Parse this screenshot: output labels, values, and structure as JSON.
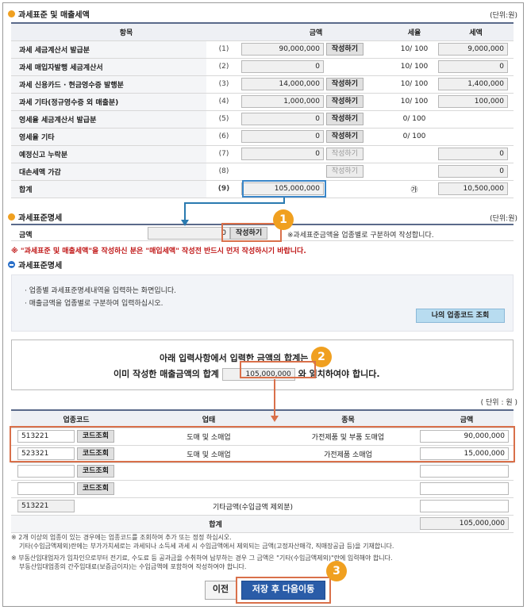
{
  "section1": {
    "title": "과세표준 및 매출세액",
    "unit": "(단위:원)",
    "headers": [
      "항목",
      "금액",
      "세율",
      "세액"
    ],
    "rows": [
      {
        "label": "과세 세금계산서 발급분",
        "no": "(1)",
        "amount": "90,000,000",
        "button": "작성하기",
        "rate": "10/ 100",
        "tax": "9,000,000"
      },
      {
        "label": "과세 매입자발행 세금계산서",
        "no": "(2)",
        "amount": "0",
        "button": "",
        "rate": "10/ 100",
        "tax": "0"
      },
      {
        "label": "과세 신용카드 · 현금영수증 발행분",
        "no": "(3)",
        "amount": "14,000,000",
        "button": "작성하기",
        "rate": "10/ 100",
        "tax": "1,400,000"
      },
      {
        "label": "과세 기타(정규영수증 외 매출분)",
        "no": "(4)",
        "amount": "1,000,000",
        "button": "작성하기",
        "rate": "10/ 100",
        "tax": "100,000"
      },
      {
        "label": "영세율 세금계산서 발급분",
        "no": "(5)",
        "amount": "0",
        "button": "작성하기",
        "rate": "0/ 100",
        "tax": ""
      },
      {
        "label": "영세율 기타",
        "no": "(6)",
        "amount": "0",
        "button": "작성하기",
        "rate": "0/ 100",
        "tax": ""
      },
      {
        "label": "예정신고 누락분",
        "no": "(7)",
        "amount": "0",
        "button": "작성하기",
        "rate": "",
        "tax": "0"
      },
      {
        "label": "대손세액 가감",
        "no": "(8)",
        "amount": "",
        "button": "작성하기",
        "rate": "",
        "tax": "0"
      }
    ],
    "total": {
      "label": "합계",
      "no": "(9)",
      "amount": "105,000,000",
      "rate_mark": "㉮",
      "tax": "10,500,000"
    }
  },
  "section2": {
    "title": "과세표준명세",
    "unit": "(단위:원)",
    "amount_label": "금액",
    "amount_value": "0",
    "button": "작성하기",
    "hint": "※과세표준금액을 업종별로 구분하여 작성합니다.",
    "warning": "※ \"과세표준 및 매출세액\"을 작성하신 분은 \"매입세액\" 작성전 반드시 먼저 작성하시기 바랍니다."
  },
  "section3": {
    "title": "과세표준명세",
    "info": [
      "· 업종별 과세표준명세내역을 입력하는 화면입니다.",
      "· 매출금액을 업종별로 구분하여 입력하십시오."
    ],
    "lookup_button": "나의 업종코드 조회",
    "msg_line1": "아래 입력사항에서  입력한 금액의 합계는",
    "msg_line2_a": "이미 작성한 매출금액의 합계",
    "msg_line2_value": "105,000,000",
    "msg_line2_b": "와 일치하여야 합니다.",
    "unit": "( 단위 : 원 )",
    "headers": [
      "업종코드",
      "업태",
      "종목",
      "금액"
    ],
    "rows": [
      {
        "code": "513221",
        "button": "코드조회",
        "biz": "도매 및 소매업",
        "item": "가전제품 및 부품 도매업",
        "amount": "90,000,000"
      },
      {
        "code": "523321",
        "button": "코드조회",
        "biz": "도매 및 소매업",
        "item": "가전제품 소매업",
        "amount": "15,000,000"
      },
      {
        "code": "",
        "button": "코드조회",
        "biz": "",
        "item": "",
        "amount": ""
      },
      {
        "code": "",
        "button": "코드조회",
        "biz": "",
        "item": "",
        "amount": ""
      }
    ],
    "other_row": {
      "code": "513221",
      "label": "기타금액(수입금액 제외분)"
    },
    "total": {
      "label": "합계",
      "amount": "105,000,000"
    },
    "notes": [
      "※ 2개 이상의 업종이 있는 경우에는 업종코드를 조회하여 추가 또는 정정 하십시오.",
      "기타(수입금액제외)란에는 부가가치세로는 과세되나 소득세 과세 시 수입금액에서 제외되는 금액(고정자산매각, 직매장공급 등)을 기재합니다.",
      "※ 부동산임대업자가 임차인으로부터 전기료, 수도료 등 공과금을 수취하여 납부하는 경우 그 금액은 \"기타(수입금액제외)\"란에 입력해야 합니다.",
      "부동산임대업종의 간주임대료(보증금이자)는 수입금액에 포함하여 작성하여야 합니다."
    ],
    "prev_button": "이전",
    "next_button": "저장 후 다음이동"
  },
  "badges": [
    "1",
    "2",
    "3"
  ],
  "colors": {
    "accent_orange": "#f0a020",
    "highlight_red": "#d9704a",
    "highlight_blue": "#3a86c8",
    "primary_button": "#2a5ca8"
  }
}
